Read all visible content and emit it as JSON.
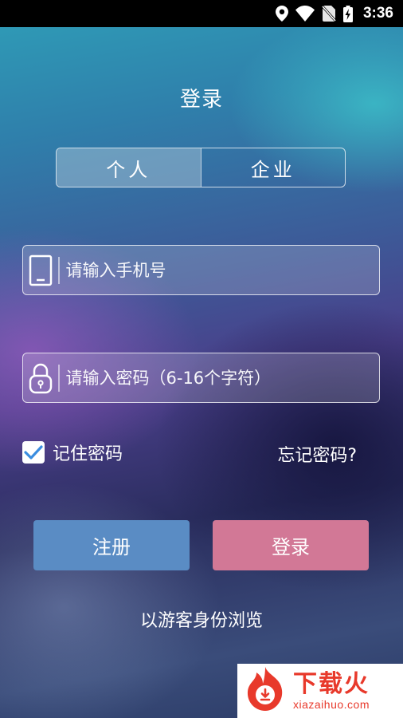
{
  "status_bar": {
    "time": "3:36",
    "icons": [
      "location-icon",
      "wifi-icon",
      "no-sim-icon",
      "battery-charging-icon"
    ]
  },
  "page": {
    "title": "登录"
  },
  "tabs": [
    {
      "label": "个人",
      "active": true
    },
    {
      "label": "企业",
      "active": false
    }
  ],
  "form": {
    "phone_placeholder": "请输入手机号",
    "phone_value": "",
    "password_placeholder": "请输入密码（6-16个字符）",
    "password_value": "",
    "remember_label": "记住密码",
    "remember_checked": true,
    "forgot_label": "忘记密码?"
  },
  "buttons": {
    "register_label": "注册",
    "login_label": "登录",
    "guest_label": "以游客身份浏览"
  },
  "watermark": {
    "main": "下载火",
    "sub": "xiazaihuo.com"
  },
  "colors": {
    "register_button": "#5a8cc4",
    "login_button": "#d27896",
    "checkbox_check": "#3a8de0",
    "watermark_red": "#e8392b"
  }
}
